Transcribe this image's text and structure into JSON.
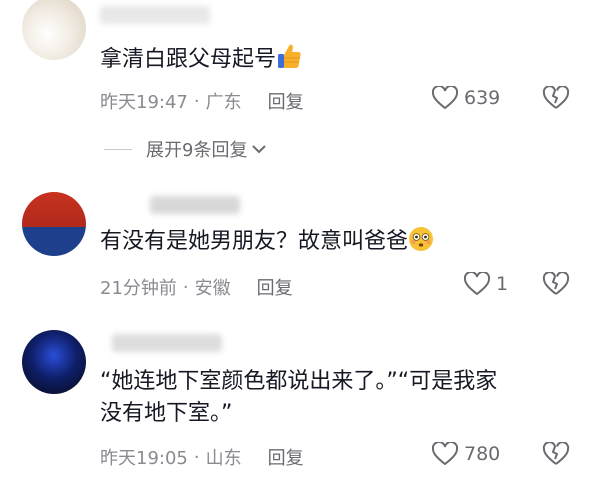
{
  "comments": [
    {
      "text": "拿清白跟父母起号",
      "time": "昨天19:47",
      "location": "广东",
      "reply_label": "回复",
      "likes": "639",
      "emoji": "thumbs-up"
    },
    {
      "text": "有没有是她男朋友？故意叫爸爸",
      "time": "21分钟前",
      "location": "安徽",
      "reply_label": "回复",
      "likes": "1",
      "emoji": "flushed-face"
    },
    {
      "text_line1": "“她连地下室颜色都说出来了。”“可是我家",
      "text_line2": "没有地下室。”",
      "time": "昨天19:05",
      "location": "山东",
      "reply_label": "回复",
      "likes": "780"
    }
  ],
  "expand_replies": "展开9条回复",
  "separator": "·",
  "colors": {
    "text": "#161823",
    "meta": "#8a8b91",
    "icon": "#6a6b70"
  }
}
